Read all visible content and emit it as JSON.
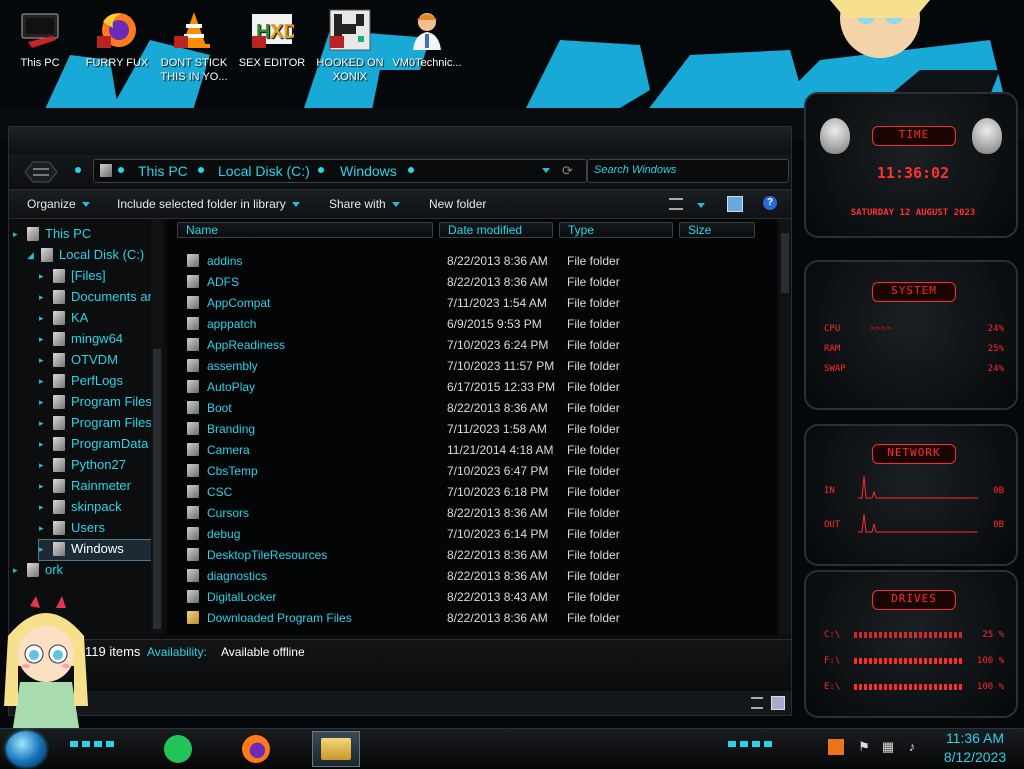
{
  "desktop_icons": [
    {
      "label": "This PC",
      "icon": "computer-icon"
    },
    {
      "label": "FURRY FUX",
      "icon": "firefox-icon"
    },
    {
      "label": "DONT STICK THIS IN YO...",
      "icon": "vlc-cone-icon"
    },
    {
      "label": "SEX EDITOR",
      "icon": "hex-editor-icon"
    },
    {
      "label": "HOOKED ON XONIX",
      "icon": "xonix-game-icon"
    },
    {
      "label": "VM0Technic...",
      "icon": "doctor-icon"
    }
  ],
  "explorer": {
    "breadcrumb": [
      "This PC",
      "Local Disk (C:)",
      "Windows"
    ],
    "search_placeholder": "Search Windows",
    "toolbar": {
      "organize": "Organize",
      "include": "Include selected folder in library",
      "share": "Share with",
      "new_folder": "New folder"
    },
    "nav_tree": [
      {
        "label": "This PC",
        "level": 0
      },
      {
        "label": "Local Disk (C:)",
        "level": 1
      },
      {
        "label": "[Files]",
        "level": 2
      },
      {
        "label": "Documents ar",
        "level": 2
      },
      {
        "label": "KA",
        "level": 2
      },
      {
        "label": "mingw64",
        "level": 2
      },
      {
        "label": "OTVDM",
        "level": 2
      },
      {
        "label": "PerfLogs",
        "level": 2
      },
      {
        "label": "Program Files",
        "level": 2
      },
      {
        "label": "Program Files",
        "level": 2
      },
      {
        "label": "ProgramData",
        "level": 2
      },
      {
        "label": "Python27",
        "level": 2
      },
      {
        "label": "Rainmeter",
        "level": 2
      },
      {
        "label": "skinpack",
        "level": 2
      },
      {
        "label": "Users",
        "level": 2
      },
      {
        "label": "Windows",
        "level": 2,
        "selected": true
      },
      {
        "label": "ork",
        "level": 0
      }
    ],
    "columns": {
      "name": "Name",
      "date": "Date modified",
      "type": "Type",
      "size": "Size"
    },
    "files": [
      {
        "name": "addins",
        "date": "8/22/2013 8:36 AM",
        "type": "File folder"
      },
      {
        "name": "ADFS",
        "date": "8/22/2013 8:36 AM",
        "type": "File folder"
      },
      {
        "name": "AppCompat",
        "date": "7/11/2023 1:54 AM",
        "type": "File folder"
      },
      {
        "name": "apppatch",
        "date": "6/9/2015 9:53 PM",
        "type": "File folder"
      },
      {
        "name": "AppReadiness",
        "date": "7/10/2023 6:24 PM",
        "type": "File folder"
      },
      {
        "name": "assembly",
        "date": "7/10/2023 11:57 PM",
        "type": "File folder"
      },
      {
        "name": "AutoPlay",
        "date": "6/17/2015 12:33 PM",
        "type": "File folder"
      },
      {
        "name": "Boot",
        "date": "8/22/2013 8:36 AM",
        "type": "File folder"
      },
      {
        "name": "Branding",
        "date": "7/11/2023 1:58 AM",
        "type": "File folder"
      },
      {
        "name": "Camera",
        "date": "11/21/2014 4:18 AM",
        "type": "File folder"
      },
      {
        "name": "CbsTemp",
        "date": "7/10/2023 6:47 PM",
        "type": "File folder"
      },
      {
        "name": "CSC",
        "date": "7/10/2023 6:18 PM",
        "type": "File folder"
      },
      {
        "name": "Cursors",
        "date": "8/22/2013 8:36 AM",
        "type": "File folder"
      },
      {
        "name": "debug",
        "date": "7/10/2023 6:14 PM",
        "type": "File folder"
      },
      {
        "name": "DesktopTileResources",
        "date": "8/22/2013 8:36 AM",
        "type": "File folder"
      },
      {
        "name": "diagnostics",
        "date": "8/22/2013 8:36 AM",
        "type": "File folder"
      },
      {
        "name": "DigitalLocker",
        "date": "8/22/2013 8:43 AM",
        "type": "File folder"
      },
      {
        "name": "Downloaded Program Files",
        "date": "8/22/2013 8:36 AM",
        "type": "File folder",
        "yellow": true
      }
    ],
    "details": {
      "item_count": "119 items",
      "availability_label": "Availability:",
      "availability_value": "Available offline"
    }
  },
  "rainmeter": {
    "time": {
      "title": "TIME",
      "clock": "11:36:02",
      "date": "SATURDAY 12 AUGUST 2023"
    },
    "system": {
      "title": "SYSTEM",
      "rows": [
        {
          "label": "CPU",
          "value": "24%"
        },
        {
          "label": "RAM",
          "value": "25%"
        },
        {
          "label": "SWAP",
          "value": "24%"
        }
      ]
    },
    "network": {
      "title": "NETWORK",
      "rows": [
        {
          "label": "IN",
          "value": "0B"
        },
        {
          "label": "OUT",
          "value": "0B"
        }
      ]
    },
    "drives": {
      "title": "DRIVES",
      "rows": [
        {
          "label": "C:\\",
          "value": "25 %"
        },
        {
          "label": "F:\\",
          "value": "100 %"
        },
        {
          "label": "E:\\",
          "value": "100 %"
        }
      ]
    }
  },
  "taskbar": {
    "clock_time": "11:36 AM",
    "clock_date": "8/12/2023",
    "apps": [
      "spotify-like-green-icon",
      "firefox-icon",
      "file-explorer-icon"
    ]
  },
  "colors": {
    "accent": "#2bd3e6",
    "rainmeter_red": "#ff2a2a",
    "wallpaper_brush": "#19a9d6"
  }
}
